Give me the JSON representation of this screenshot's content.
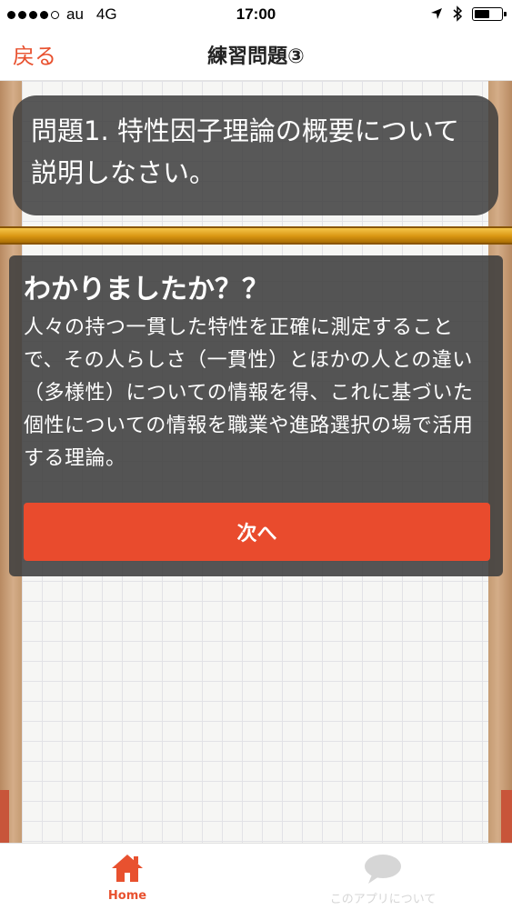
{
  "status_bar": {
    "carrier": "au",
    "network": "4G",
    "time": "17:00",
    "battery_level": 0.6
  },
  "nav": {
    "back_label": "戻る",
    "title": "練習問題③"
  },
  "question": {
    "text": "問題1. 特性因子理論の概要について説明しなさい。"
  },
  "answer": {
    "heading": "わかりましたか？？",
    "text": "人々の持つ一貫した特性を正確に測定することで、その人らしさ（一貫性）とほかの人との違い（多様性）についての情報を得、これに基づいた個性についての情報を職業や進路選択の場で活用する理論。"
  },
  "next_button": {
    "label": "次へ"
  },
  "tab_bar": {
    "tabs": [
      {
        "label": "Home",
        "icon": "house-icon",
        "active": true
      },
      {
        "label": "このアプリについて",
        "icon": "speech-bubble-icon",
        "active": false
      }
    ]
  },
  "colors": {
    "accent": "#e8512f",
    "button": "#e94b2d",
    "overlay": "#3e3e3e",
    "gold": "#d99612"
  }
}
